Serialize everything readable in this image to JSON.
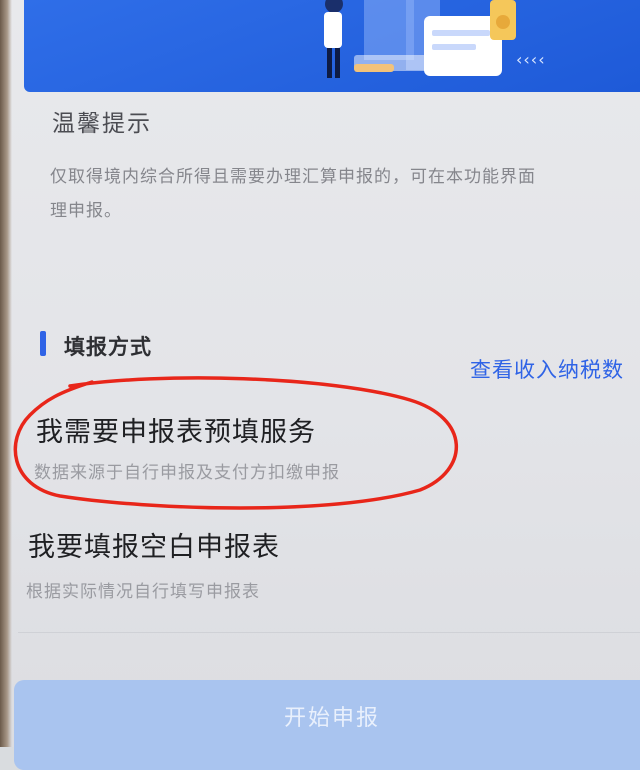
{
  "tips": {
    "title": "温馨提示",
    "text": "仅取得境内综合所得且需要办理汇算申报的，可在本功能界面\n理申报。"
  },
  "fill_method": {
    "section_title": "填报方式",
    "income_link": "查看收入纳税数"
  },
  "options": [
    {
      "title": "我需要申报表预填服务",
      "desc": "数据来源于自行申报及支付方扣缴申报"
    },
    {
      "title": "我要填报空白申报表",
      "desc": "根据实际情况自行填写申报表"
    }
  ],
  "start_button": {
    "label": "开始申报"
  },
  "colors": {
    "accent": "#2f63e6",
    "banner": "#2462e0",
    "annotation": "#e8261a",
    "disabled_button": "#a9c4ef"
  }
}
